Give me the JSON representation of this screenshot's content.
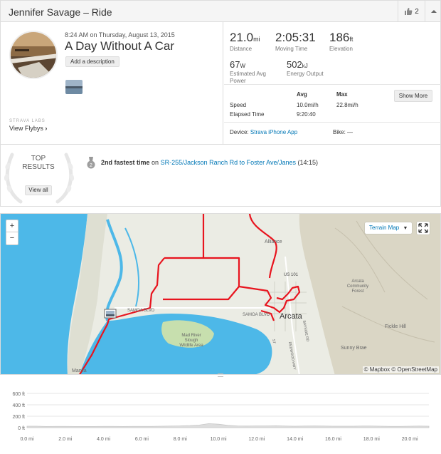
{
  "header": {
    "title": "Jennifer Savage – Ride",
    "kudos_count": "2",
    "icons": [
      "thumbs-up-icon",
      "caret-up-icon"
    ]
  },
  "activity": {
    "date": "8:24 AM on Thursday, August 13, 2015",
    "title": "A Day Without A Car",
    "add_description": "Add a description",
    "labs_label": "STRAVA LABS",
    "flybys_label": "View Flybys"
  },
  "stats": {
    "distance": {
      "value": "21.0",
      "unit": "mi",
      "label": "Distance"
    },
    "moving_time": {
      "value": "2:05:31",
      "label": "Moving Time"
    },
    "elevation": {
      "value": "186",
      "unit": "ft",
      "label": "Elevation"
    },
    "avg_power": {
      "value": "67",
      "unit": "W",
      "label_line1": "Estimated Avg",
      "label_line2": "Power"
    },
    "energy": {
      "value": "502",
      "unit": "kJ",
      "label": "Energy Output"
    }
  },
  "details": {
    "col_avg": "Avg",
    "col_max": "Max",
    "show_more": "Show More",
    "speed_label": "Speed",
    "speed_avg": "10.0mi/h",
    "speed_max": "22.8mi/h",
    "elapsed_label": "Elapsed Time",
    "elapsed_value": "9:20:40",
    "device_label": "Device:",
    "device_value": "Strava iPhone App",
    "bike_label": "Bike:",
    "bike_value": "—"
  },
  "results": {
    "top_line1": "TOP",
    "top_line2": "RESULTS",
    "view_all": "View all",
    "medal_number": "2",
    "achievement_bold": "2nd fastest time",
    "achievement_on": "on",
    "segment": "SR-255/Jackson Ranch Rd to Foster Ave/Janes",
    "time": "(14:15)"
  },
  "map": {
    "zoom_in": "+",
    "zoom_out": "−",
    "terrain_label": "Terrain Map",
    "attribution": "© Mapbox © OpenStreetMap",
    "labels": {
      "alliance": "Alliance",
      "us101": "US 101",
      "samoa1": "SAMOA BLVD",
      "samoa2": "SAMOA BLVD",
      "arcata": "Arcata",
      "arcata_forest": "Arcata\nCommunity\nForest",
      "fickle": "Fickle Hill",
      "sunny": "Sunny Brae",
      "madriver": "Mad River\nSlough\nWildlife Area",
      "manila": "Manila",
      "redwood": "REDWOOD HWY",
      "bayside": "BAYSIDE RD",
      "st": "ST"
    },
    "route_color": "#e8141e",
    "water_color": "#4db8e8",
    "land_color": "#e9e9e0"
  },
  "chart_data": {
    "type": "area",
    "y_ticks": [
      "600 ft",
      "400 ft",
      "200 ft",
      "0 ft"
    ],
    "x_ticks": [
      "0.0 mi",
      "2.0 mi",
      "4.0 mi",
      "6.0 mi",
      "8.0 mi",
      "10.0 mi",
      "12.0 mi",
      "14.0 mi",
      "16.0 mi",
      "18.0 mi",
      "20.0 mi"
    ],
    "ylim": [
      0,
      600
    ],
    "xlim": [
      0,
      21
    ],
    "x": [
      0,
      0.5,
      1,
      1.5,
      2,
      2.5,
      3,
      3.5,
      4,
      4.5,
      5,
      5.5,
      6,
      6.5,
      7,
      7.5,
      8,
      8.5,
      9,
      9.5,
      10,
      10.5,
      11,
      11.5,
      12,
      12.5,
      13,
      13.5,
      14,
      14.5,
      15,
      15.5,
      16,
      16.5,
      17,
      17.5,
      18,
      18.5,
      19,
      19.5,
      20,
      20.5,
      21
    ],
    "elevation": [
      25,
      25,
      20,
      22,
      22,
      20,
      20,
      20,
      22,
      22,
      20,
      22,
      22,
      22,
      25,
      28,
      30,
      35,
      45,
      70,
      60,
      40,
      30,
      28,
      30,
      30,
      32,
      28,
      25,
      28,
      30,
      28,
      25,
      25,
      25,
      28,
      28,
      25,
      22,
      22,
      25,
      28,
      25
    ],
    "grid": true,
    "fill_color": "#dddddd"
  }
}
